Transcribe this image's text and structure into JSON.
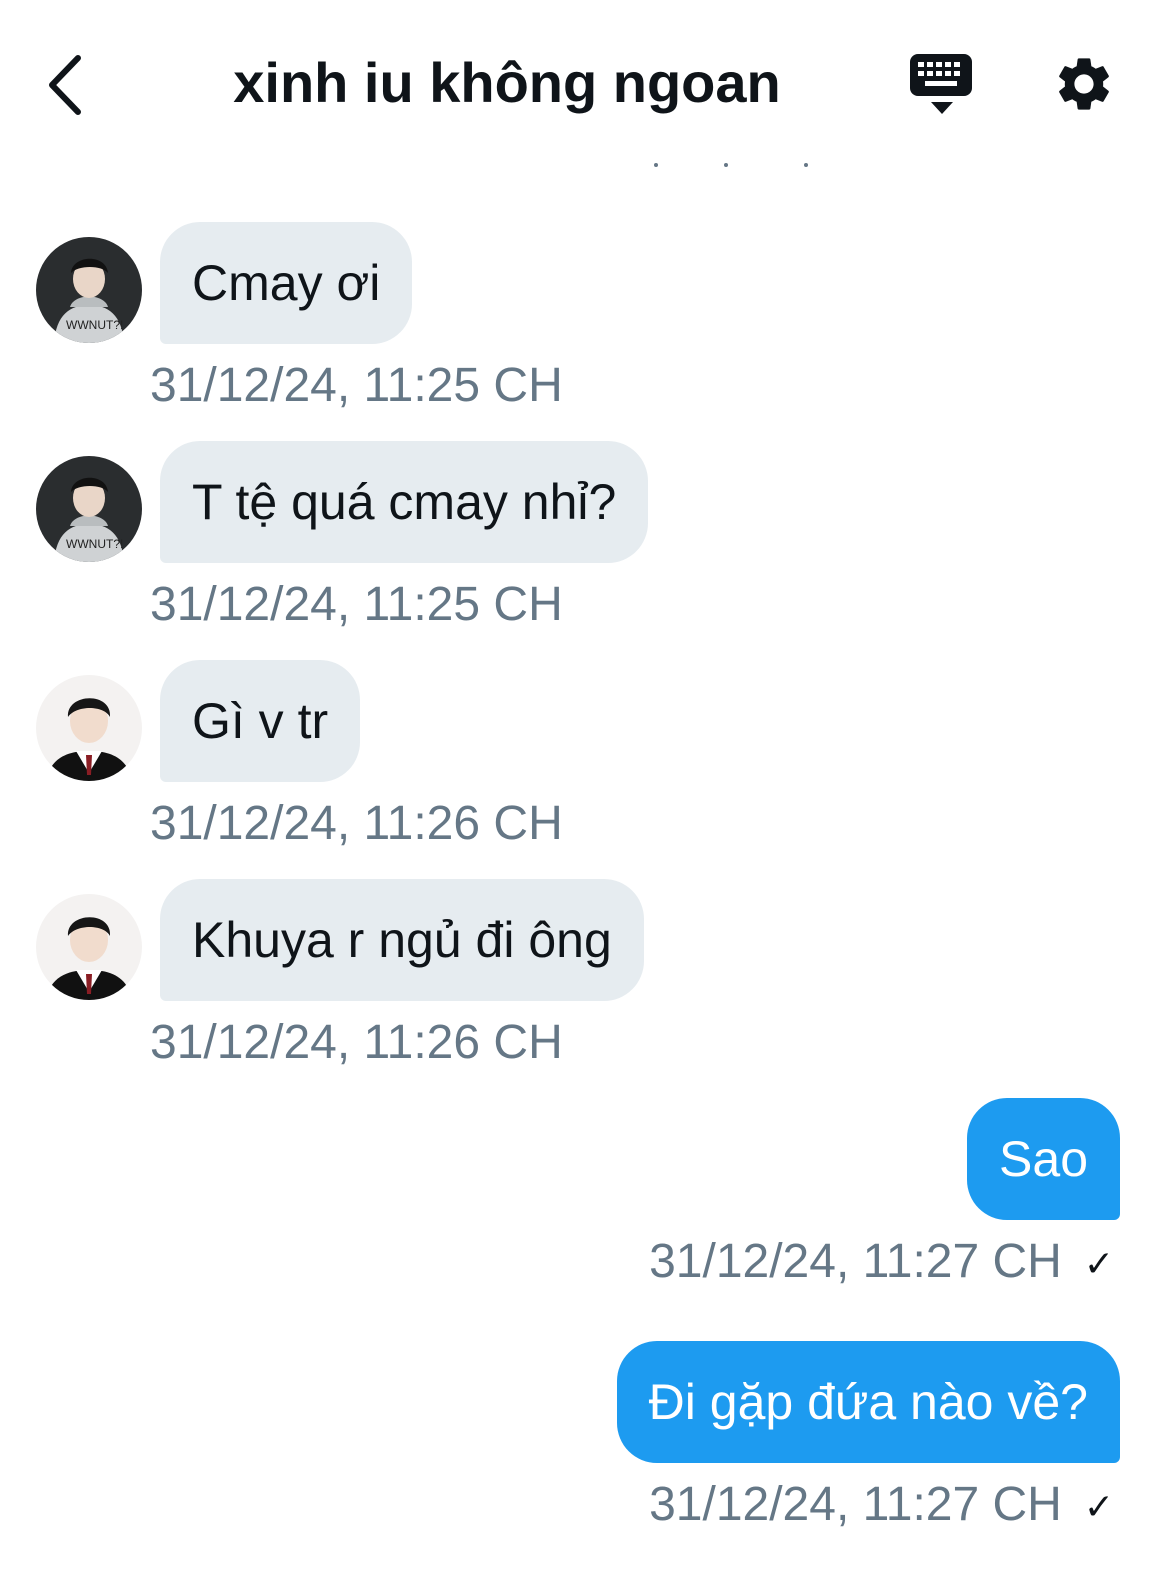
{
  "header": {
    "title": "xinh iu không ngoan"
  },
  "colors": {
    "incoming_bubble": "#e6ecf0",
    "outgoing_bubble": "#1d9bf0",
    "timestamp": "#657786"
  },
  "messages": [
    {
      "direction": "incoming",
      "sender": "contact-a",
      "text": "Cmay ơi",
      "time": "31/12/24, 11:25 CH"
    },
    {
      "direction": "incoming",
      "sender": "contact-a",
      "text": "T tệ quá cmay nhỉ?",
      "time": "31/12/24, 11:25 CH"
    },
    {
      "direction": "incoming",
      "sender": "contact-b",
      "text": "Gì v tr",
      "time": "31/12/24, 11:26 CH"
    },
    {
      "direction": "incoming",
      "sender": "contact-b",
      "text": "Khuya r ngủ đi ông",
      "time": "31/12/24, 11:26 CH"
    },
    {
      "direction": "outgoing",
      "text": "Sao",
      "time": "31/12/24, 11:27 CH",
      "status": "✓"
    },
    {
      "direction": "outgoing",
      "text": "Đi gặp đứa nào về?",
      "time": "31/12/24, 11:27 CH",
      "status": "✓"
    }
  ],
  "icons": {
    "back": "chevron-left-icon",
    "keyboard": "keyboard-icon",
    "settings": "gear-icon"
  }
}
